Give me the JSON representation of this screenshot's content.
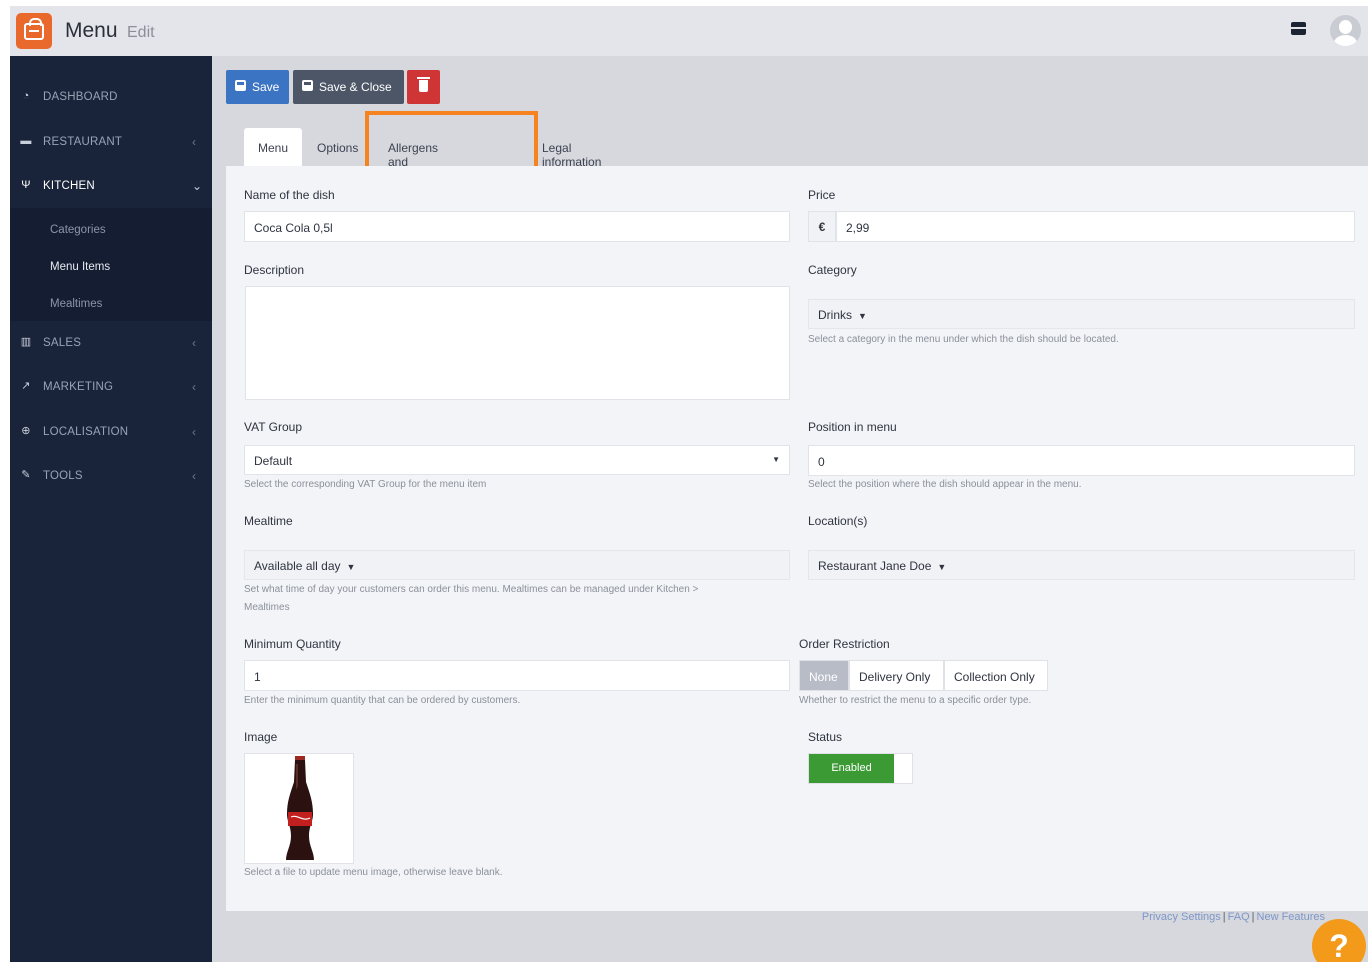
{
  "app": {
    "title": "Menu",
    "subtitle": "Edit"
  },
  "sidebar": {
    "items": [
      {
        "label": "DASHBOARD",
        "icon": "dashboard-icon"
      },
      {
        "label": "RESTAURANT",
        "icon": "store-icon"
      },
      {
        "label": "KITCHEN",
        "icon": "utensils-icon"
      },
      {
        "label": "SALES",
        "icon": "chart-bar-icon"
      },
      {
        "label": "MARKETING",
        "icon": "chart-line-icon"
      },
      {
        "label": "LOCALISATION",
        "icon": "globe-icon"
      },
      {
        "label": "TOOLS",
        "icon": "wrench-icon"
      }
    ],
    "kitchen_sub": [
      "Categories",
      "Menu Items",
      "Mealtimes"
    ]
  },
  "toolbar": {
    "save": "Save",
    "save_close": "Save & Close"
  },
  "tabs": [
    "Menu",
    "Options",
    "Allergens and additives",
    "Legal information"
  ],
  "form": {
    "name": {
      "label": "Name of the dish",
      "value": "Coca Cola 0,5l"
    },
    "price": {
      "label": "Price",
      "currency": "€",
      "value": "2,99"
    },
    "description": {
      "label": "Description",
      "value": ""
    },
    "category": {
      "label": "Category",
      "value": "Drinks",
      "help": "Select a category in the menu under which the dish should be located."
    },
    "vat": {
      "label": "VAT Group",
      "value": "Default",
      "help": "Select the corresponding VAT Group for the menu item"
    },
    "position": {
      "label": "Position in menu",
      "value": "0",
      "help": "Select the position where the dish should appear in the menu."
    },
    "mealtime": {
      "label": "Mealtime",
      "value": "Available all day",
      "help_line1": "Set what time of day your customers can order this menu. Mealtimes can be managed under Kitchen >",
      "help_line2": "Mealtimes"
    },
    "locations": {
      "label": "Location(s)",
      "value": "Restaurant Jane Doe"
    },
    "min_qty": {
      "label": "Minimum Quantity",
      "value": "1",
      "help": "Enter the minimum quantity that can be ordered by customers."
    },
    "order_restriction": {
      "label": "Order Restriction",
      "options": [
        "None",
        "Delivery Only",
        "Collection Only"
      ],
      "selected": "None",
      "help": "Whether to restrict the menu to a specific order type."
    },
    "image": {
      "label": "Image",
      "help": "Select a file to update menu image, otherwise leave blank."
    },
    "status": {
      "label": "Status",
      "value": "Enabled"
    }
  },
  "footer": {
    "links": [
      "Privacy Settings",
      "FAQ",
      "New Features"
    ],
    "help_icon": "?"
  }
}
